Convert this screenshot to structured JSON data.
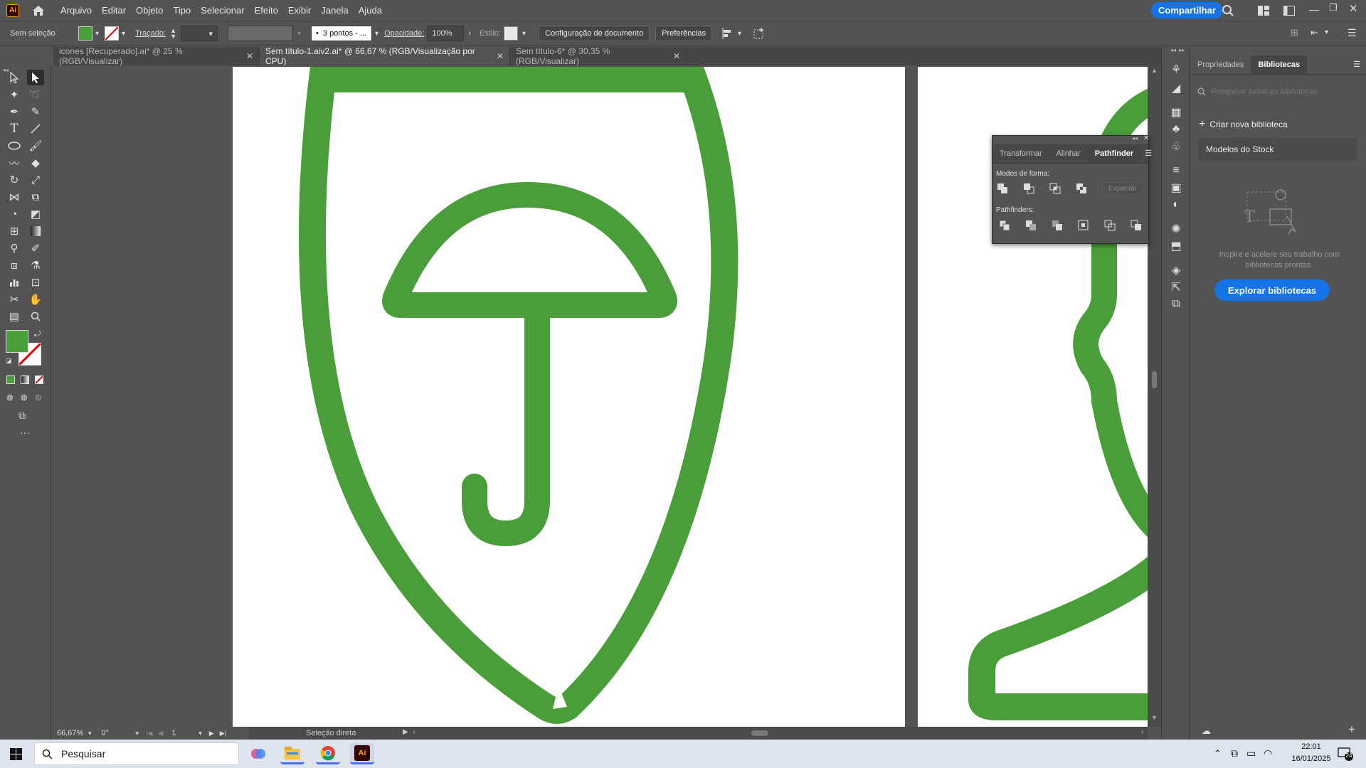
{
  "app": {
    "logo": "Ai",
    "menu": [
      "Arquivo",
      "Editar",
      "Objeto",
      "Tipo",
      "Selecionar",
      "Efeito",
      "Exibir",
      "Janela",
      "Ajuda"
    ],
    "share_label": "Compartilhar"
  },
  "control_bar": {
    "selection_label": "Sem seleção",
    "fill_color": "#4a9e3a",
    "stroke_label": "Traçado:",
    "brush_value": "3 pontos - ...",
    "opacity_label": "Opacidade:",
    "opacity_value": "100%",
    "style_label": "Estilo:",
    "doc_setup_label": "Configuração de documento",
    "preferences_label": "Preferências"
  },
  "tabs": [
    {
      "label": "icones [Recuperado].ai* @ 25 % (RGB/Visualizar)",
      "active": false
    },
    {
      "label": "Sem título-1.aiv2.ai* @ 66,67 % (RGB/Visualização por CPU)",
      "active": true
    },
    {
      "label": "Sem título-6* @ 30,35 % (RGB/Visualizar)",
      "active": false
    }
  ],
  "status_bar": {
    "zoom": "66,67%",
    "rotation": "0°",
    "artboard_number": "1",
    "tool_status": "Seleção direta"
  },
  "artwork": {
    "green": "#4a9e3a"
  },
  "pathfinder_panel": {
    "tabs": [
      "Transformar",
      "Alinhar",
      "Pathfinder"
    ],
    "active_tab": "Pathfinder",
    "shape_modes_label": "Modos de forma:",
    "expand_label": "Expandir",
    "pathfinders_label": "Pathfinders:"
  },
  "libraries_panel": {
    "tabs": [
      "Propriedades",
      "Bibliotecas"
    ],
    "active_tab": "Bibliotecas",
    "search_placeholder": "Pesquisar todas as bibliotecas",
    "create_label": "Criar nova biblioteca",
    "stock_label": "Modelos do Stock",
    "promo_text": "Inspire e acelere seu trabalho com bibliotecas prontas.",
    "explore_label": "Explorar bibliotecas"
  },
  "taskbar": {
    "search_placeholder": "Pesquisar",
    "time": "22:01",
    "date": "16/01/2025",
    "notification_count": "24"
  }
}
